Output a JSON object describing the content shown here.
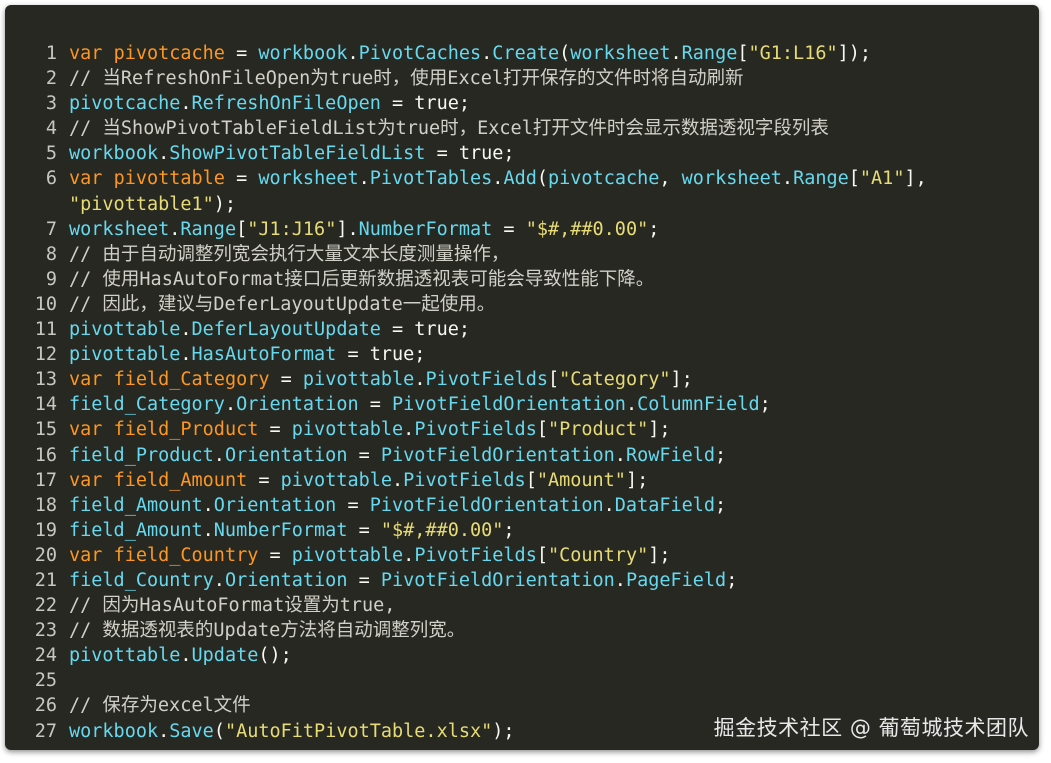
{
  "lines": [
    {
      "n": "1",
      "tokens": [
        [
          "kw",
          "var"
        ],
        [
          "p",
          " "
        ],
        [
          "v",
          "pivotcache"
        ],
        [
          "p",
          " = "
        ],
        [
          "m",
          "workbook"
        ],
        [
          "p",
          "."
        ],
        [
          "m",
          "PivotCaches"
        ],
        [
          "p",
          "."
        ],
        [
          "m",
          "Create"
        ],
        [
          "p",
          "("
        ],
        [
          "m",
          "worksheet"
        ],
        [
          "p",
          "."
        ],
        [
          "m",
          "Range"
        ],
        [
          "p",
          "["
        ],
        [
          "s",
          "\"G1:L16\""
        ],
        [
          "p",
          "]);"
        ]
      ]
    },
    {
      "n": "2",
      "tokens": [
        [
          "c",
          "// 当RefreshOnFileOpen为true时，使用Excel打开保存的文件时将自动刷新"
        ]
      ]
    },
    {
      "n": "3",
      "tokens": [
        [
          "m",
          "pivotcache"
        ],
        [
          "p",
          "."
        ],
        [
          "m",
          "RefreshOnFileOpen"
        ],
        [
          "p",
          " = true;"
        ]
      ]
    },
    {
      "n": "4",
      "tokens": [
        [
          "c",
          "// 当ShowPivotTableFieldList为true时，Excel打开文件时会显示数据透视字段列表"
        ]
      ]
    },
    {
      "n": "5",
      "tokens": [
        [
          "m",
          "workbook"
        ],
        [
          "p",
          "."
        ],
        [
          "m",
          "ShowPivotTableFieldList"
        ],
        [
          "p",
          " = true;"
        ]
      ]
    },
    {
      "n": "6",
      "tokens": [
        [
          "kw",
          "var"
        ],
        [
          "p",
          " "
        ],
        [
          "v",
          "pivottable"
        ],
        [
          "p",
          " = "
        ],
        [
          "m",
          "worksheet"
        ],
        [
          "p",
          "."
        ],
        [
          "m",
          "PivotTables"
        ],
        [
          "p",
          "."
        ],
        [
          "m",
          "Add"
        ],
        [
          "p",
          "("
        ],
        [
          "m",
          "pivotcache"
        ],
        [
          "p",
          ", "
        ],
        [
          "m",
          "worksheet"
        ],
        [
          "p",
          "."
        ],
        [
          "m",
          "Range"
        ],
        [
          "p",
          "["
        ],
        [
          "s",
          "\"A1\""
        ],
        [
          "p",
          "],"
        ]
      ]
    },
    {
      "n": "",
      "tokens": [
        [
          "s",
          "\"pivottable1\""
        ],
        [
          "p",
          ");"
        ]
      ]
    },
    {
      "n": "7",
      "tokens": [
        [
          "m",
          "worksheet"
        ],
        [
          "p",
          "."
        ],
        [
          "m",
          "Range"
        ],
        [
          "p",
          "["
        ],
        [
          "s",
          "\"J1:J16\""
        ],
        [
          "p",
          "]."
        ],
        [
          "m",
          "NumberFormat"
        ],
        [
          "p",
          " = "
        ],
        [
          "s",
          "\"$#,##0.00\""
        ],
        [
          "p",
          ";"
        ]
      ]
    },
    {
      "n": "8",
      "tokens": [
        [
          "c",
          "// 由于自动调整列宽会执行大量文本长度测量操作，"
        ]
      ]
    },
    {
      "n": "9",
      "tokens": [
        [
          "c",
          "// 使用HasAutoFormat接口后更新数据透视表可能会导致性能下降。"
        ]
      ]
    },
    {
      "n": "10",
      "tokens": [
        [
          "c",
          "// 因此，建议与DeferLayoutUpdate一起使用。"
        ]
      ]
    },
    {
      "n": "11",
      "tokens": [
        [
          "m",
          "pivottable"
        ],
        [
          "p",
          "."
        ],
        [
          "m",
          "DeferLayoutUpdate"
        ],
        [
          "p",
          " = true;"
        ]
      ]
    },
    {
      "n": "12",
      "tokens": [
        [
          "m",
          "pivottable"
        ],
        [
          "p",
          "."
        ],
        [
          "m",
          "HasAutoFormat"
        ],
        [
          "p",
          " = true;"
        ]
      ]
    },
    {
      "n": "13",
      "tokens": [
        [
          "kw",
          "var"
        ],
        [
          "p",
          " "
        ],
        [
          "v",
          "field_Category"
        ],
        [
          "p",
          " = "
        ],
        [
          "m",
          "pivottable"
        ],
        [
          "p",
          "."
        ],
        [
          "m",
          "PivotFields"
        ],
        [
          "p",
          "["
        ],
        [
          "s",
          "\"Category\""
        ],
        [
          "p",
          "];"
        ]
      ]
    },
    {
      "n": "14",
      "tokens": [
        [
          "m",
          "field_Category"
        ],
        [
          "p",
          "."
        ],
        [
          "m",
          "Orientation"
        ],
        [
          "p",
          " = "
        ],
        [
          "m",
          "PivotFieldOrientation"
        ],
        [
          "p",
          "."
        ],
        [
          "m",
          "ColumnField"
        ],
        [
          "p",
          ";"
        ]
      ]
    },
    {
      "n": "15",
      "tokens": [
        [
          "kw",
          "var"
        ],
        [
          "p",
          " "
        ],
        [
          "v",
          "field_Product"
        ],
        [
          "p",
          " = "
        ],
        [
          "m",
          "pivottable"
        ],
        [
          "p",
          "."
        ],
        [
          "m",
          "PivotFields"
        ],
        [
          "p",
          "["
        ],
        [
          "s",
          "\"Product\""
        ],
        [
          "p",
          "];"
        ]
      ]
    },
    {
      "n": "16",
      "tokens": [
        [
          "m",
          "field_Product"
        ],
        [
          "p",
          "."
        ],
        [
          "m",
          "Orientation"
        ],
        [
          "p",
          " = "
        ],
        [
          "m",
          "PivotFieldOrientation"
        ],
        [
          "p",
          "."
        ],
        [
          "m",
          "RowField"
        ],
        [
          "p",
          ";"
        ]
      ]
    },
    {
      "n": "17",
      "tokens": [
        [
          "kw",
          "var"
        ],
        [
          "p",
          " "
        ],
        [
          "v",
          "field_Amount"
        ],
        [
          "p",
          " = "
        ],
        [
          "m",
          "pivottable"
        ],
        [
          "p",
          "."
        ],
        [
          "m",
          "PivotFields"
        ],
        [
          "p",
          "["
        ],
        [
          "s",
          "\"Amount\""
        ],
        [
          "p",
          "];"
        ]
      ]
    },
    {
      "n": "18",
      "tokens": [
        [
          "m",
          "field_Amount"
        ],
        [
          "p",
          "."
        ],
        [
          "m",
          "Orientation"
        ],
        [
          "p",
          " = "
        ],
        [
          "m",
          "PivotFieldOrientation"
        ],
        [
          "p",
          "."
        ],
        [
          "m",
          "DataField"
        ],
        [
          "p",
          ";"
        ]
      ]
    },
    {
      "n": "19",
      "tokens": [
        [
          "m",
          "field_Amount"
        ],
        [
          "p",
          "."
        ],
        [
          "m",
          "NumberFormat"
        ],
        [
          "p",
          " = "
        ],
        [
          "s",
          "\"$#,##0.00\""
        ],
        [
          "p",
          ";"
        ]
      ]
    },
    {
      "n": "20",
      "tokens": [
        [
          "kw",
          "var"
        ],
        [
          "p",
          " "
        ],
        [
          "v",
          "field_Country"
        ],
        [
          "p",
          " = "
        ],
        [
          "m",
          "pivottable"
        ],
        [
          "p",
          "."
        ],
        [
          "m",
          "PivotFields"
        ],
        [
          "p",
          "["
        ],
        [
          "s",
          "\"Country\""
        ],
        [
          "p",
          "];"
        ]
      ]
    },
    {
      "n": "21",
      "tokens": [
        [
          "m",
          "field_Country"
        ],
        [
          "p",
          "."
        ],
        [
          "m",
          "Orientation"
        ],
        [
          "p",
          " = "
        ],
        [
          "m",
          "PivotFieldOrientation"
        ],
        [
          "p",
          "."
        ],
        [
          "m",
          "PageField"
        ],
        [
          "p",
          ";"
        ]
      ]
    },
    {
      "n": "22",
      "tokens": [
        [
          "c",
          "// 因为HasAutoFormat设置为true,"
        ]
      ]
    },
    {
      "n": "23",
      "tokens": [
        [
          "c",
          "// 数据透视表的Update方法将自动调整列宽。"
        ]
      ]
    },
    {
      "n": "24",
      "tokens": [
        [
          "m",
          "pivottable"
        ],
        [
          "p",
          "."
        ],
        [
          "m",
          "Update"
        ],
        [
          "p",
          "();"
        ]
      ]
    },
    {
      "n": "25",
      "tokens": []
    },
    {
      "n": "26",
      "tokens": [
        [
          "c",
          "// 保存为excel文件"
        ]
      ]
    },
    {
      "n": "27",
      "tokens": [
        [
          "m",
          "workbook"
        ],
        [
          "p",
          "."
        ],
        [
          "m",
          "Save"
        ],
        [
          "p",
          "("
        ],
        [
          "s",
          "\"AutoFitPivotTable.xlsx\""
        ],
        [
          "p",
          ");"
        ]
      ]
    }
  ],
  "watermark": "掘金技术社区 @ 葡萄城技术团队",
  "colors": {
    "background": "#272822",
    "keyword": "#fd971f",
    "member": "#66d9ef",
    "string": "#e6db74",
    "plain": "#f8f8f2",
    "comment": "#d8d8d0"
  }
}
